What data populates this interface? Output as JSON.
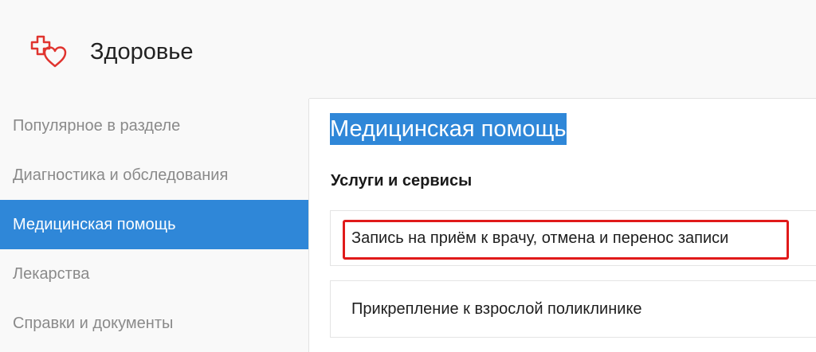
{
  "header": {
    "app_title": "Здоровье",
    "logo_icon": "cross-heart-icon",
    "logo_color": "#e0342f"
  },
  "sidebar": {
    "items": [
      {
        "label": "Популярное в разделе",
        "active": false
      },
      {
        "label": "Диагностика и обследования",
        "active": false
      },
      {
        "label": "Медицинская помощь",
        "active": true
      },
      {
        "label": "Лекарства",
        "active": false
      },
      {
        "label": "Справки и документы",
        "active": false
      }
    ],
    "active_color": "#2f87d8"
  },
  "main": {
    "section_title": "Медицинская помощь",
    "subsection_title": "Услуги и сервисы",
    "services": [
      {
        "label": "Запись на приём к врачу, отмена и перенос записи",
        "highlighted": true
      },
      {
        "label": "Прикрепление к взрослой поликлинике",
        "highlighted": false
      }
    ],
    "highlight_color": "#e01a1a"
  }
}
